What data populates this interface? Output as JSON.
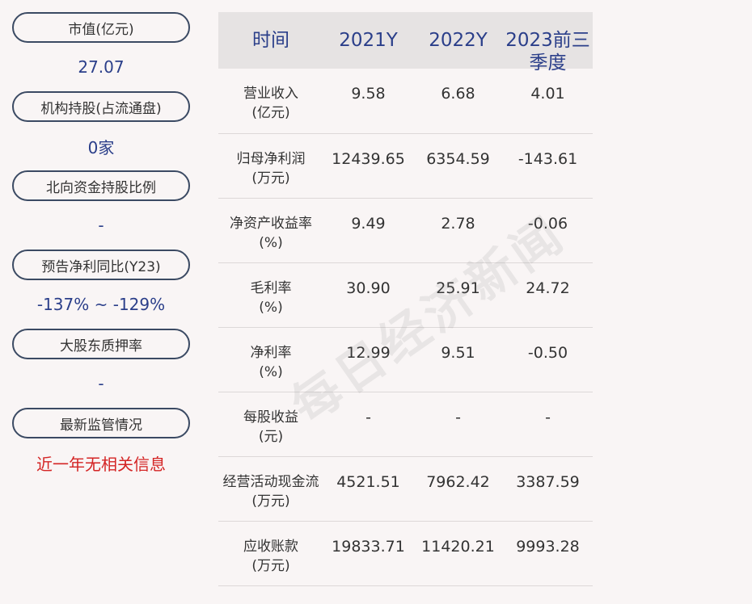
{
  "left": [
    {
      "label": "市值(亿元)",
      "value": "27.07",
      "red": false
    },
    {
      "label": "机构持股(占流通盘)",
      "value": "0家",
      "red": false
    },
    {
      "label": "北向资金持股比例",
      "value": "-",
      "red": false
    },
    {
      "label": "预告净利同比(Y23)",
      "value": "-137% ~ -129%",
      "red": false
    },
    {
      "label": "大股东质押率",
      "value": "-",
      "red": false
    },
    {
      "label": "最新监管情况",
      "value": "近一年无相关信息",
      "red": true
    }
  ],
  "table": {
    "headers": [
      "时间",
      "2021Y",
      "2022Y",
      "2023前三季度"
    ],
    "rows": [
      {
        "label1": "营业收入",
        "label2": "(亿元)",
        "v": [
          "9.58",
          "6.68",
          "4.01"
        ]
      },
      {
        "label1": "归母净利润",
        "label2": "(万元)",
        "v": [
          "12439.65",
          "6354.59",
          "-143.61"
        ]
      },
      {
        "label1": "净资产收益率",
        "label2": "(%)",
        "v": [
          "9.49",
          "2.78",
          "-0.06"
        ]
      },
      {
        "label1": "毛利率",
        "label2": "(%)",
        "v": [
          "30.90",
          "25.91",
          "24.72"
        ]
      },
      {
        "label1": "净利率",
        "label2": "(%)",
        "v": [
          "12.99",
          "9.51",
          "-0.50"
        ]
      },
      {
        "label1": "每股收益",
        "label2": "(元)",
        "v": [
          "-",
          "-",
          "-"
        ]
      },
      {
        "label1": "经营活动现金流",
        "label2": "(万元)",
        "v": [
          "4521.51",
          "7962.42",
          "3387.59"
        ]
      },
      {
        "label1": "应收账款",
        "label2": "(万元)",
        "v": [
          "19833.71",
          "11420.21",
          "9993.28"
        ]
      }
    ]
  },
  "watermark": "每日经济新闻",
  "colors": {
    "accent": "#2b3f8a",
    "alert": "#d42424",
    "border": "#3b4a63"
  }
}
